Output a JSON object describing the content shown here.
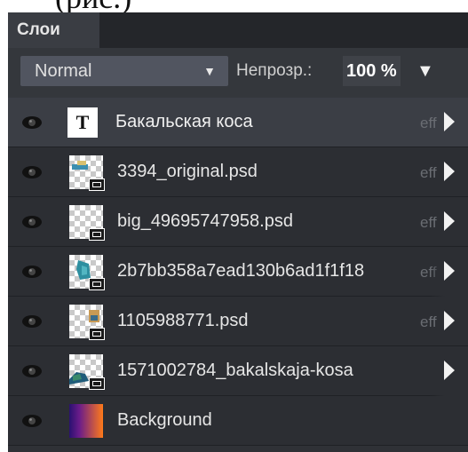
{
  "panel": {
    "tab_label": "Слои",
    "blend_mode": "Normal",
    "opacity_label": "Непрозр.:",
    "opacity_value": "100 %",
    "effects_label": "eff"
  },
  "layers": [
    {
      "name": "Бакальская коса",
      "type": "text",
      "thumb_letter": "T",
      "selected": true
    },
    {
      "name": "3394_original.psd",
      "type": "smart"
    },
    {
      "name": "big_49695747958.psd",
      "type": "smart"
    },
    {
      "name": "2b7bb358a7ead130b6ad1f1f18",
      "type": "smart"
    },
    {
      "name": "1105988771.psd",
      "type": "smart"
    },
    {
      "name": "1571002784_bakalskaja-kosa",
      "type": "smart"
    },
    {
      "name": "Background",
      "type": "background"
    }
  ],
  "colors": {
    "panel_bg": "#2f3136",
    "selected_row": "#3b3e45",
    "text": "#e6e6e6",
    "dim_text": "#6a6d73"
  },
  "icons": [
    "eye-icon",
    "smart-object-icon",
    "expand-arrow-icon",
    "dropdown-caret-icon"
  ]
}
